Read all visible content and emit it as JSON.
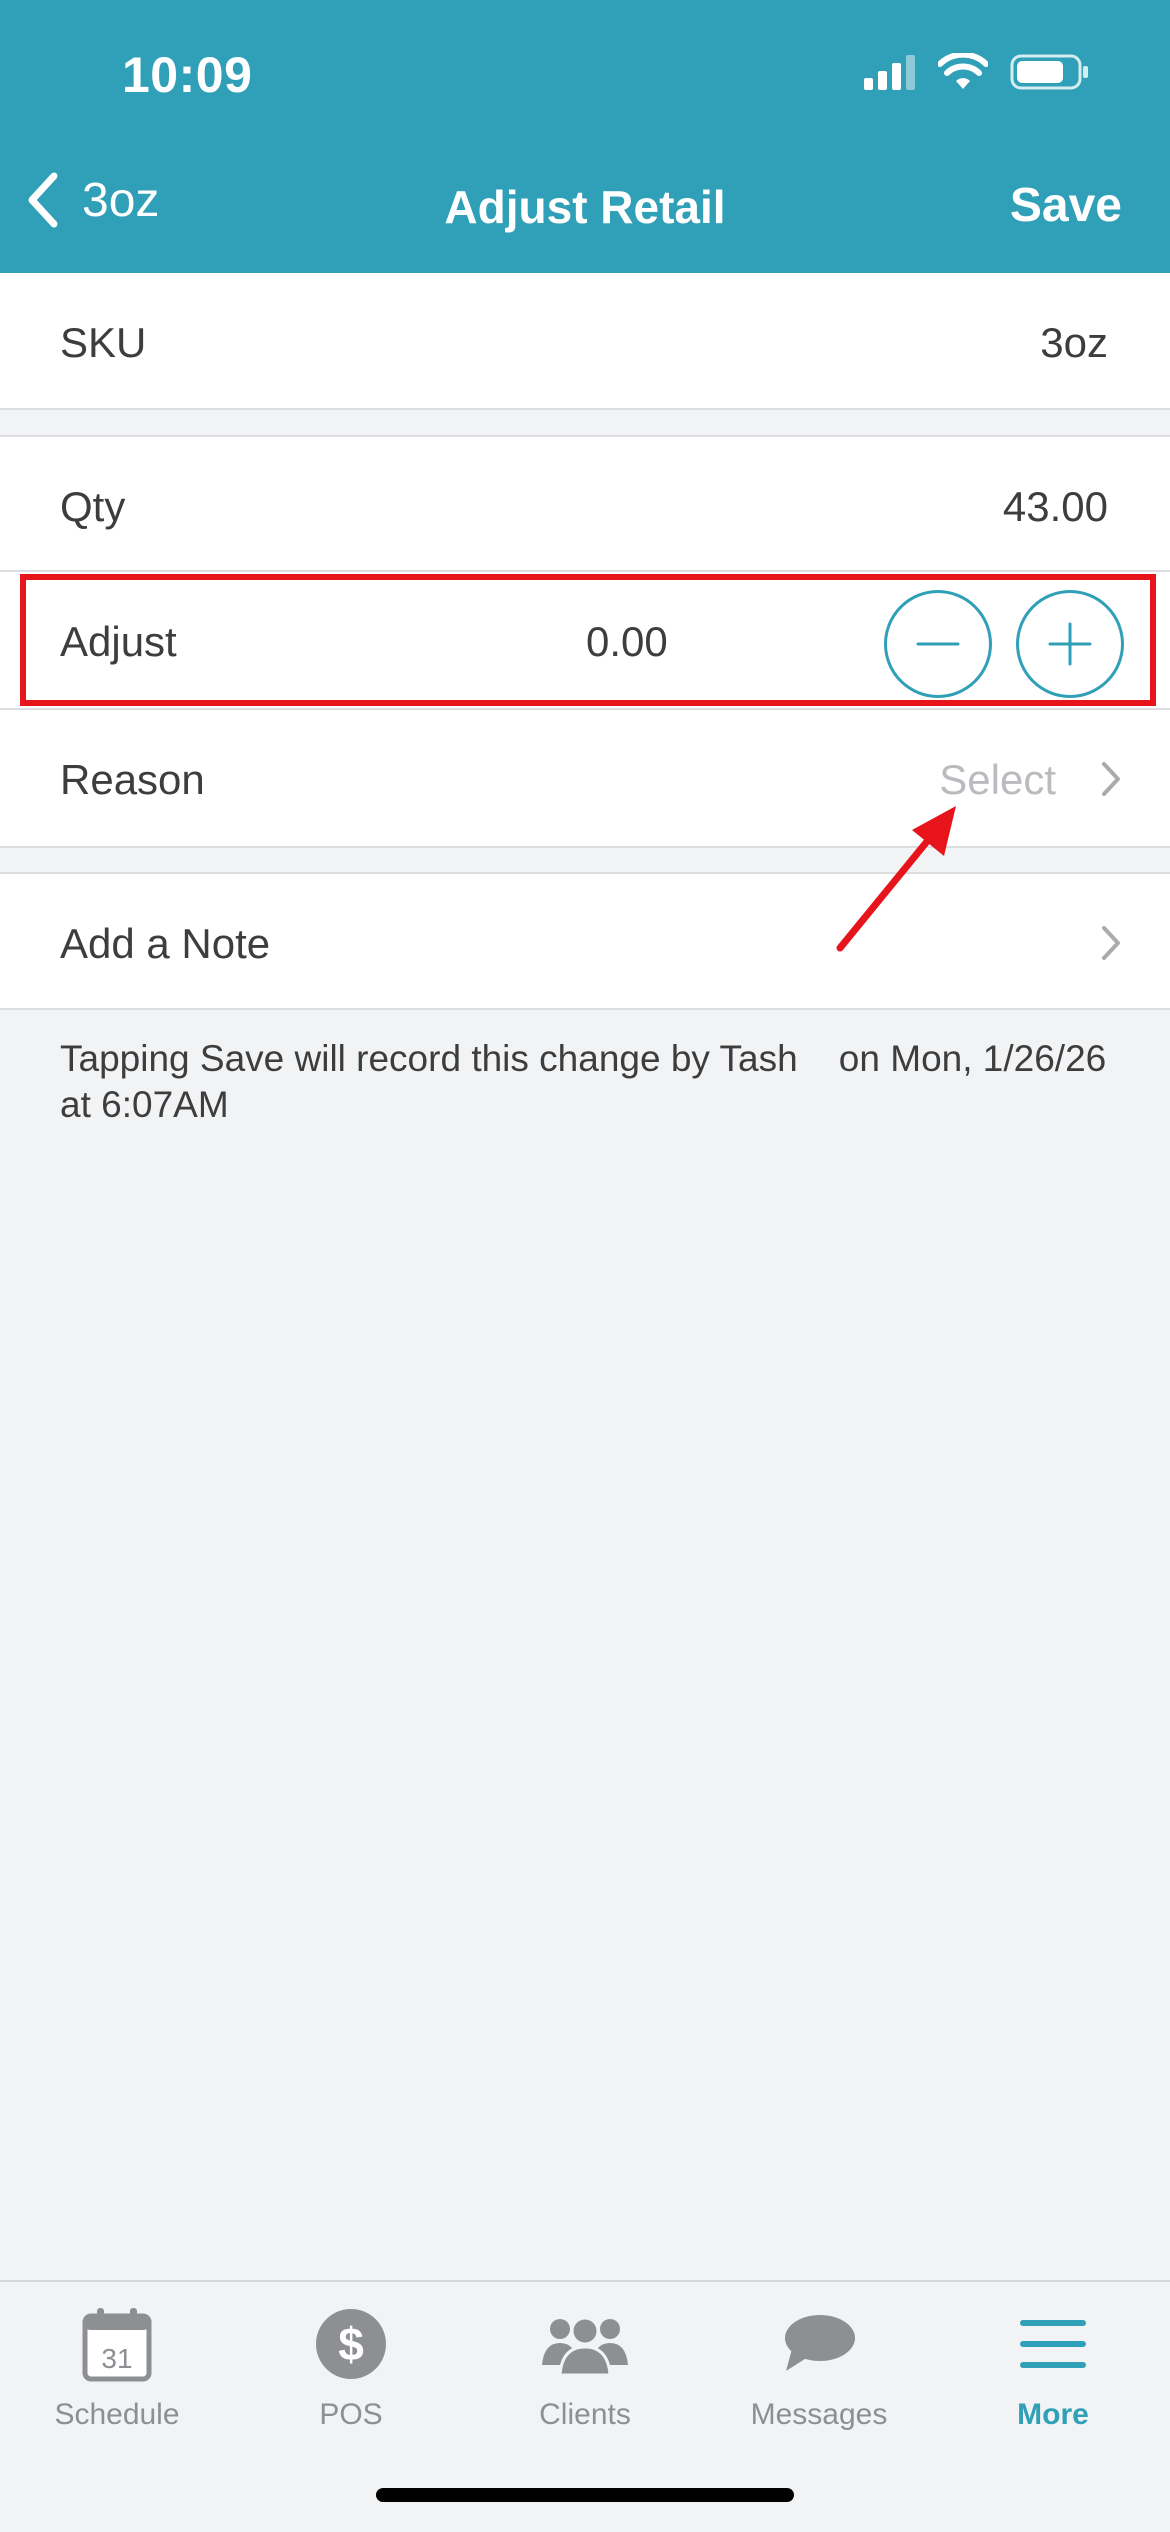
{
  "status_bar": {
    "time": "10:09"
  },
  "nav": {
    "back_label": "3oz",
    "title": "Adjust Retail",
    "save_label": "Save"
  },
  "rows": {
    "sku": {
      "label": "SKU",
      "value": "3oz"
    },
    "qty": {
      "label": "Qty",
      "value": "43.00"
    },
    "adjust": {
      "label": "Adjust",
      "value": "0.00"
    },
    "reason": {
      "label": "Reason",
      "placeholder": "Select"
    },
    "note": {
      "label": "Add a Note"
    }
  },
  "footer_note": {
    "line1": "Tapping Save will record this change by Tash    on Mon, 1/26/26",
    "line2": "at 6:07AM"
  },
  "tabs": [
    {
      "label": "Schedule",
      "icon": "calendar-icon",
      "calendar_day": "31"
    },
    {
      "label": "POS",
      "icon": "dollar-icon"
    },
    {
      "label": "Clients",
      "icon": "people-icon"
    },
    {
      "label": "Messages",
      "icon": "chat-bubble-icon"
    },
    {
      "label": "More",
      "icon": "menu-icon",
      "active": true
    }
  ],
  "colors": {
    "accent": "#309fb8",
    "annotation": "#e8141c",
    "background": "#f2f3f5"
  }
}
